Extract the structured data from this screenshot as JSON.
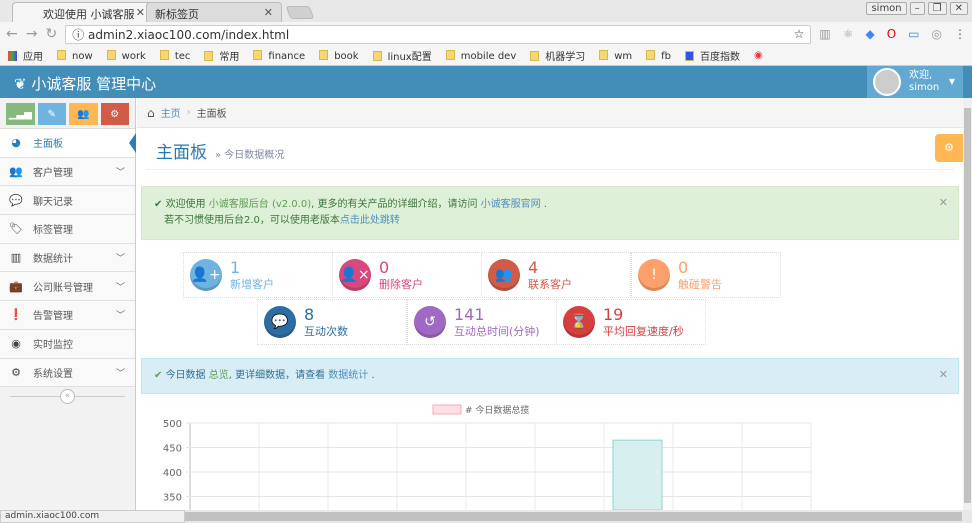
{
  "browser": {
    "tabs": [
      {
        "title": "欢迎使用 小诚客服"
      },
      {
        "title": "新标签页"
      }
    ],
    "profile": "simon",
    "url": "admin2.xiaoc100.com/index.html",
    "bookmarks": [
      "应用",
      "now",
      "work",
      "tec",
      "常用",
      "finance",
      "book",
      "linux配置",
      "mobile dev",
      "机器学习",
      "wm",
      "fb",
      "百度指数"
    ]
  },
  "header": {
    "brand": "小诚客服 管理中心",
    "welcome": "欢迎,",
    "user": "simon"
  },
  "sidebar": {
    "items": [
      {
        "label": "主面板",
        "icon": "dashboard-icon"
      },
      {
        "label": "客户管理",
        "icon": "users-icon"
      },
      {
        "label": "聊天记录",
        "icon": "wechat-icon"
      },
      {
        "label": "标签管理",
        "icon": "tag-icon"
      },
      {
        "label": "数据统计",
        "icon": "bar-chart-icon"
      },
      {
        "label": "公司账号管理",
        "icon": "briefcase-icon"
      },
      {
        "label": "告警管理",
        "icon": "exclamation-icon"
      },
      {
        "label": "实时监控",
        "icon": "eye-icon"
      },
      {
        "label": "系统设置",
        "icon": "cog-icon"
      }
    ]
  },
  "breadcrumb": {
    "home": "主页",
    "current": "主面板"
  },
  "page": {
    "title": "主面板",
    "subtitle": "» 今日数据概况"
  },
  "alert_success": {
    "t1": "欢迎使用",
    "brand": "小诚客服后台",
    "version": "(v2.0.0)",
    "t2": ", 更多的有关产品的详细介绍，请访问",
    "site": "小诚客服官网",
    "t3": ".",
    "t4": "若不习惯使用后台2.0，可以使用老版本",
    "link": "点击此处跳转"
  },
  "stats": [
    {
      "value": "1",
      "label": "新增客户",
      "color": "#6fb3e0"
    },
    {
      "value": "0",
      "label": "删除客户",
      "color": "#d6487e"
    },
    {
      "value": "4",
      "label": "联系客户",
      "color": "#d15b47"
    },
    {
      "value": "0",
      "label": "触碰警告",
      "color": "#fea06c"
    },
    {
      "value": "8",
      "label": "互动次数",
      "color": "#2e6da4"
    },
    {
      "value": "141",
      "label": "互动总时间(分钟)",
      "color": "#a069c3"
    },
    {
      "value": "19",
      "label": "平均回复速度/秒",
      "color": "#d53f40"
    }
  ],
  "alert_info": {
    "t1": "今日数据",
    "link1": "总览",
    "t2": ", 更详细数据，请查看",
    "link2": "数据统计",
    "t3": "."
  },
  "statusbar": {
    "url": "admin.xiaoc100.com"
  },
  "chart_data": {
    "type": "bar",
    "legend": "# 今日数据总揽",
    "legend_position": "top",
    "categories_count": 9,
    "values": [
      null,
      null,
      null,
      null,
      null,
      null,
      465,
      null,
      null
    ],
    "yticks": [
      500,
      450,
      400,
      350
    ],
    "ylim": [
      300,
      500
    ],
    "grid": true
  }
}
